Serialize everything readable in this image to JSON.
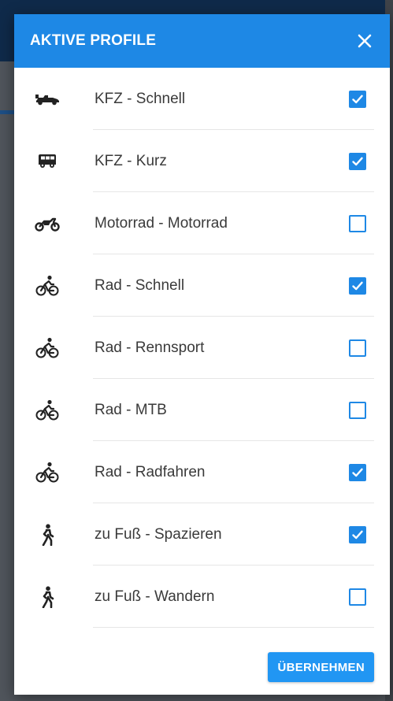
{
  "colors": {
    "accent": "#1e88e5",
    "header_bg": "#1e88e5",
    "button_bg": "#2196f3",
    "text": "#3a3a3a"
  },
  "dialog": {
    "title": "AKTIVE PROFILE",
    "close_icon": "close-icon",
    "apply_label": "ÜBERNEHMEN"
  },
  "profiles": [
    {
      "label": "KFZ - Schnell",
      "icon": "race-car-icon",
      "checked": true
    },
    {
      "label": "KFZ - Kurz",
      "icon": "van-icon",
      "checked": true
    },
    {
      "label": "Motorrad - Motorrad",
      "icon": "motorcycle-icon",
      "checked": false
    },
    {
      "label": "Rad - Schnell",
      "icon": "bicycle-icon",
      "checked": true
    },
    {
      "label": "Rad - Rennsport",
      "icon": "bicycle-icon",
      "checked": false
    },
    {
      "label": "Rad - MTB",
      "icon": "bicycle-icon",
      "checked": false
    },
    {
      "label": "Rad - Radfahren",
      "icon": "bicycle-icon",
      "checked": true
    },
    {
      "label": "zu Fuß - Spazieren",
      "icon": "walking-icon",
      "checked": true
    },
    {
      "label": "zu Fuß - Wandern",
      "icon": "walking-icon",
      "checked": false
    }
  ]
}
